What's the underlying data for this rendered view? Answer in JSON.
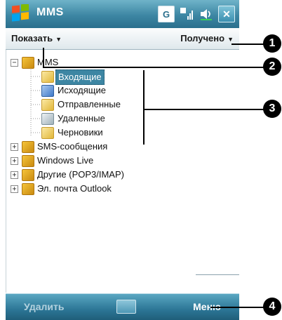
{
  "titlebar": {
    "title": "MMS",
    "status_g": "G",
    "close_label": "✕"
  },
  "toolbar": {
    "show_label": "Показать",
    "sort_label": "Получено"
  },
  "tree": {
    "root": {
      "label": "MMS",
      "expander": "−"
    },
    "children": [
      {
        "label": "Входящие"
      },
      {
        "label": "Исходящие"
      },
      {
        "label": "Отправленные"
      },
      {
        "label": "Удаленные"
      },
      {
        "label": "Черновики"
      }
    ],
    "accounts": [
      {
        "label": "SMS-сообщения",
        "expander": "+"
      },
      {
        "label": "Windows Live",
        "expander": "+"
      },
      {
        "label": "Другие (POP3/IMAP)",
        "expander": "+"
      },
      {
        "label": "Эл. почта Outlook",
        "expander": "+"
      }
    ]
  },
  "softkeys": {
    "left": "Удалить",
    "right": "Меню"
  },
  "callouts": [
    "1",
    "2",
    "3",
    "4"
  ],
  "colors": {
    "accent": "#3d86a3",
    "titlebar": "#2a6f8d"
  }
}
